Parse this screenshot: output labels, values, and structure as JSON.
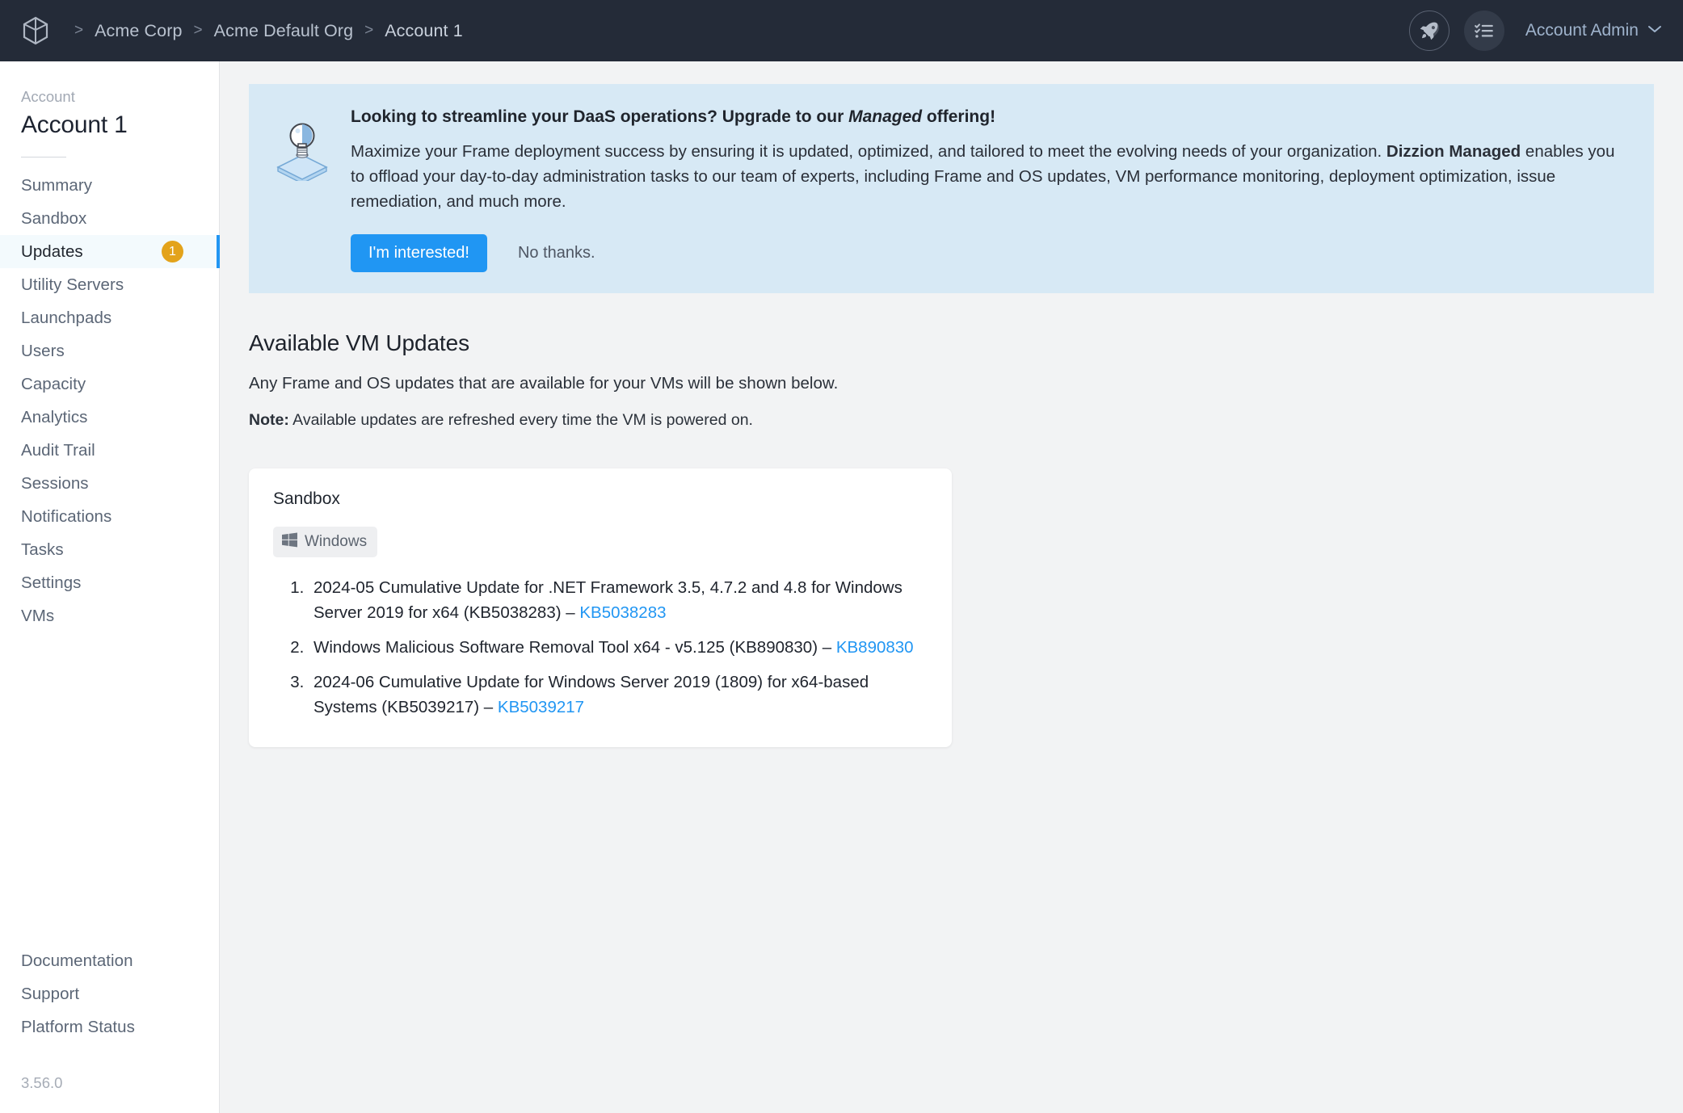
{
  "topbar": {
    "logo_icon": "cube-logo-icon",
    "breadcrumbs": [
      {
        "label": "Acme Corp"
      },
      {
        "label": "Acme Default Org"
      },
      {
        "label": "Account 1"
      }
    ],
    "separator": ">",
    "rocket_icon": "rocket-icon",
    "tasks_icon": "checklist-icon",
    "user_label": "Account Admin",
    "chevron_icon": "chevron-down-icon",
    "bg_color": "#242b38",
    "crumb_color": "#b9c2cf"
  },
  "sidebar": {
    "kicker": "Account",
    "title": "Account 1",
    "items": [
      {
        "label": "Summary",
        "active": false,
        "badge": ""
      },
      {
        "label": "Sandbox",
        "active": false,
        "badge": ""
      },
      {
        "label": "Updates",
        "active": true,
        "badge": "1"
      },
      {
        "label": "Utility Servers",
        "active": false,
        "badge": ""
      },
      {
        "label": "Launchpads",
        "active": false,
        "badge": ""
      },
      {
        "label": "Users",
        "active": false,
        "badge": ""
      },
      {
        "label": "Capacity",
        "active": false,
        "badge": ""
      },
      {
        "label": "Analytics",
        "active": false,
        "badge": ""
      },
      {
        "label": "Audit Trail",
        "active": false,
        "badge": ""
      },
      {
        "label": "Sessions",
        "active": false,
        "badge": ""
      },
      {
        "label": "Notifications",
        "active": false,
        "badge": ""
      },
      {
        "label": "Tasks",
        "active": false,
        "badge": ""
      },
      {
        "label": "Settings",
        "active": false,
        "badge": ""
      },
      {
        "label": "VMs",
        "active": false,
        "badge": ""
      }
    ],
    "bottom_items": [
      {
        "label": "Documentation"
      },
      {
        "label": "Support"
      },
      {
        "label": "Platform Status"
      }
    ],
    "version": "3.56.0",
    "active_accent_color": "#2196f3",
    "badge_color": "#e3a31b"
  },
  "banner": {
    "icon": "lightbulb-on-box-icon",
    "title_part1": "Looking to streamline your DaaS operations? Upgrade to our ",
    "title_emphasis": "Managed",
    "title_part2": " offering!",
    "text_part1": "Maximize your Frame deployment success by ensuring it is updated, optimized, and tailored to meet the evolving needs of your organization. ",
    "text_bold": "Dizzion Managed",
    "text_part2": " enables you to offload your day-to-day administration tasks to our team of experts, including Frame and OS updates, VM performance monitoring, deployment optimization, issue remediation, and much more.",
    "primary_button": "I'm interested!",
    "secondary_button": "No thanks.",
    "bg_color": "#d7e9f5",
    "primary_color": "#2096f3"
  },
  "content": {
    "heading": "Available VM Updates",
    "subtitle": "Any Frame and OS updates that are available for your VMs will be shown below.",
    "note_label": "Note:",
    "note_text": " Available updates are refreshed every time the VM is powered on."
  },
  "vm_card": {
    "name": "Sandbox",
    "os_icon": "windows-logo-icon",
    "os_label": "Windows",
    "updates": [
      {
        "text": "2024-05 Cumulative Update for .NET Framework 3.5, 4.7.2 and 4.8 for Windows Server 2019 for x64 (KB5038283) – ",
        "kb": "KB5038283"
      },
      {
        "text": "Windows Malicious Software Removal Tool x64 - v5.125 (KB890830) – ",
        "kb": "KB890830"
      },
      {
        "text": "2024-06 Cumulative Update for Windows Server 2019 (1809) for x64-based Systems (KB5039217) – ",
        "kb": "KB5039217"
      }
    ],
    "link_color": "#2196f3"
  }
}
